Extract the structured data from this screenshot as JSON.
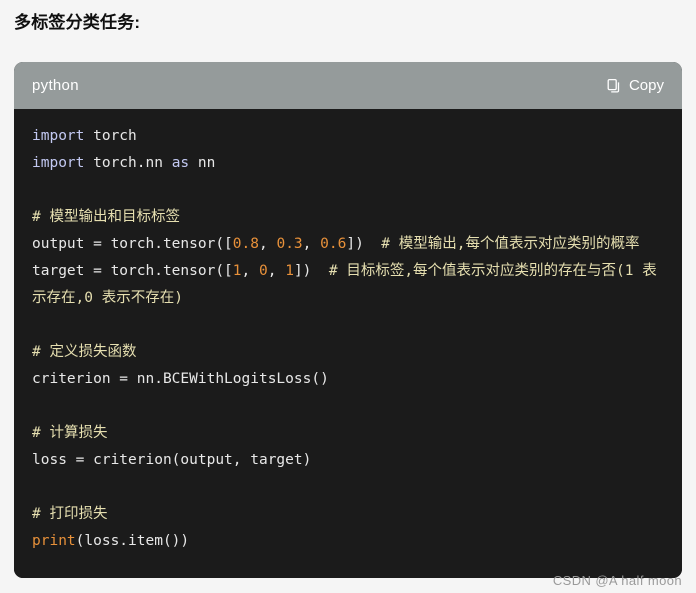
{
  "page": {
    "title": "多标签分类任务:",
    "background_color": "#f5f5f5",
    "watermark": "CSDN @A half moon"
  },
  "code_block": {
    "language_label": "python",
    "header_background": "#959b9b",
    "body_background": "#1b1b1b",
    "copy_button": {
      "label": "Copy",
      "icon": "copy-icon"
    },
    "syntax_colors": {
      "keyword": "#c3c9f2",
      "plain": "#e8e8e8",
      "number": "#e8913a",
      "builtin_function": "#e8913a",
      "comment": "#e6dfb0"
    },
    "lines": [
      {
        "id": "line-1",
        "tokens": [
          {
            "t": "import",
            "c": "kw"
          },
          {
            "t": " torch",
            "c": "plain"
          }
        ]
      },
      {
        "id": "line-2",
        "tokens": [
          {
            "t": "import",
            "c": "kw"
          },
          {
            "t": " torch.nn ",
            "c": "plain"
          },
          {
            "t": "as",
            "c": "kw"
          },
          {
            "t": " nn",
            "c": "plain"
          }
        ]
      },
      {
        "id": "line-3",
        "blank": true,
        "tokens": []
      },
      {
        "id": "line-4",
        "tokens": [
          {
            "t": "# 模型输出和目标标签",
            "c": "com"
          }
        ]
      },
      {
        "id": "line-5",
        "tokens": [
          {
            "t": "output = torch.tensor([",
            "c": "plain"
          },
          {
            "t": "0.8",
            "c": "num"
          },
          {
            "t": ", ",
            "c": "plain"
          },
          {
            "t": "0.3",
            "c": "num"
          },
          {
            "t": ", ",
            "c": "plain"
          },
          {
            "t": "0.6",
            "c": "num"
          },
          {
            "t": "])  ",
            "c": "plain"
          },
          {
            "t": "# 模型输出,每个值表示对应类别的概率",
            "c": "com"
          }
        ]
      },
      {
        "id": "line-6",
        "tokens": [
          {
            "t": "target = torch.tensor([",
            "c": "plain"
          },
          {
            "t": "1",
            "c": "num"
          },
          {
            "t": ", ",
            "c": "plain"
          },
          {
            "t": "0",
            "c": "num"
          },
          {
            "t": ", ",
            "c": "plain"
          },
          {
            "t": "1",
            "c": "num"
          },
          {
            "t": "])  ",
            "c": "plain"
          },
          {
            "t": "# 目标标签,每个值表示对应类别的存在与否(1 表示存在,0 表示不存在)",
            "c": "com"
          }
        ]
      },
      {
        "id": "line-7",
        "blank": true,
        "tokens": []
      },
      {
        "id": "line-8",
        "tokens": [
          {
            "t": "# 定义损失函数",
            "c": "com"
          }
        ]
      },
      {
        "id": "line-9",
        "tokens": [
          {
            "t": "criterion = nn.BCEWithLogitsLoss()",
            "c": "plain"
          }
        ]
      },
      {
        "id": "line-10",
        "blank": true,
        "tokens": []
      },
      {
        "id": "line-11",
        "tokens": [
          {
            "t": "# 计算损失",
            "c": "com"
          }
        ]
      },
      {
        "id": "line-12",
        "tokens": [
          {
            "t": "loss = criterion(output, target)",
            "c": "plain"
          }
        ]
      },
      {
        "id": "line-13",
        "blank": true,
        "tokens": []
      },
      {
        "id": "line-14",
        "tokens": [
          {
            "t": "# 打印损失",
            "c": "com"
          }
        ]
      },
      {
        "id": "line-15",
        "tokens": [
          {
            "t": "print",
            "c": "fn"
          },
          {
            "t": "(loss.item())",
            "c": "plain"
          }
        ]
      }
    ]
  }
}
